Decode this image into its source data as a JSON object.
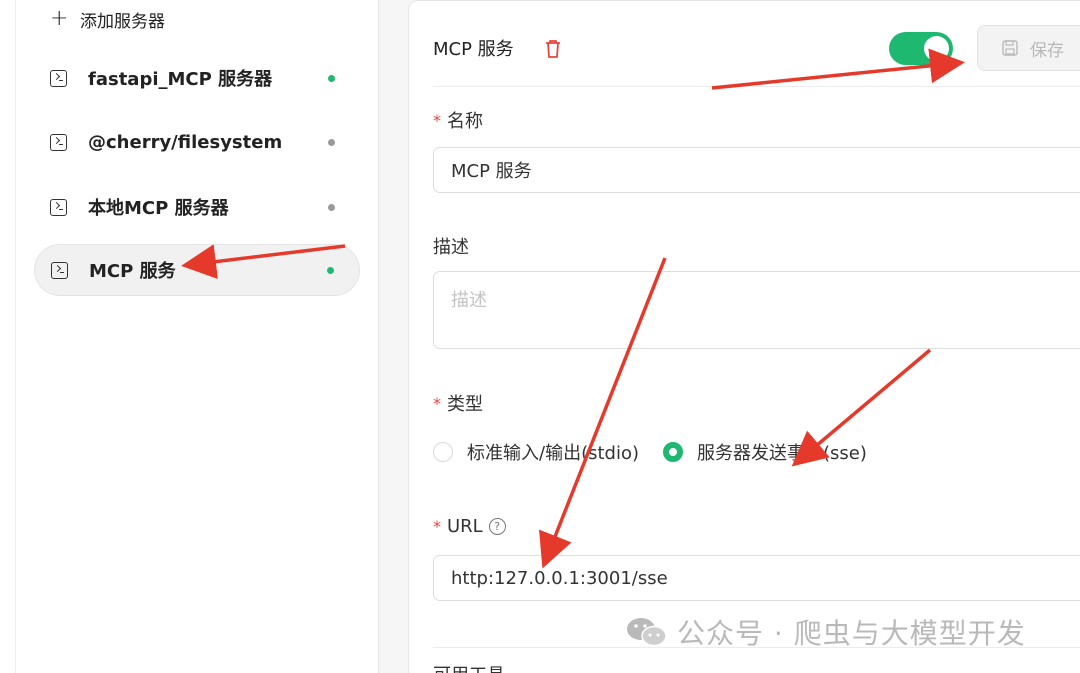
{
  "sidebar": {
    "add_label": "添加服务器",
    "items": [
      {
        "name": "fastapi_MCP 服务器",
        "status_color": "#1fb870"
      },
      {
        "name": "@cherry/filesystem",
        "status_color": "#9a9a9a"
      },
      {
        "name": "本地MCP 服务器",
        "status_color": "#9a9a9a"
      },
      {
        "name": "MCP 服务",
        "status_color": "#1fb870",
        "active": true
      }
    ]
  },
  "panel": {
    "title": "MCP 服务",
    "enabled": true,
    "save_label": "保存",
    "name_label": "名称",
    "name_value": "MCP 服务",
    "desc_label": "描述",
    "desc_placeholder": "描述",
    "type_label": "类型",
    "type_options": [
      "标准输入/输出(stdio)",
      "服务器发送事件(sse)"
    ],
    "type_selected": "服务器发送事件(sse)",
    "url_label": "URL",
    "url_value": "http:127.0.0.1:3001/sse",
    "tools_label": "可用工具"
  },
  "watermark": {
    "text": "公众号 · 爬虫与大模型开发"
  },
  "colors": {
    "accent": "#1fb870",
    "required": "#e6463e",
    "annotation_arrow": "#e53a2b"
  }
}
